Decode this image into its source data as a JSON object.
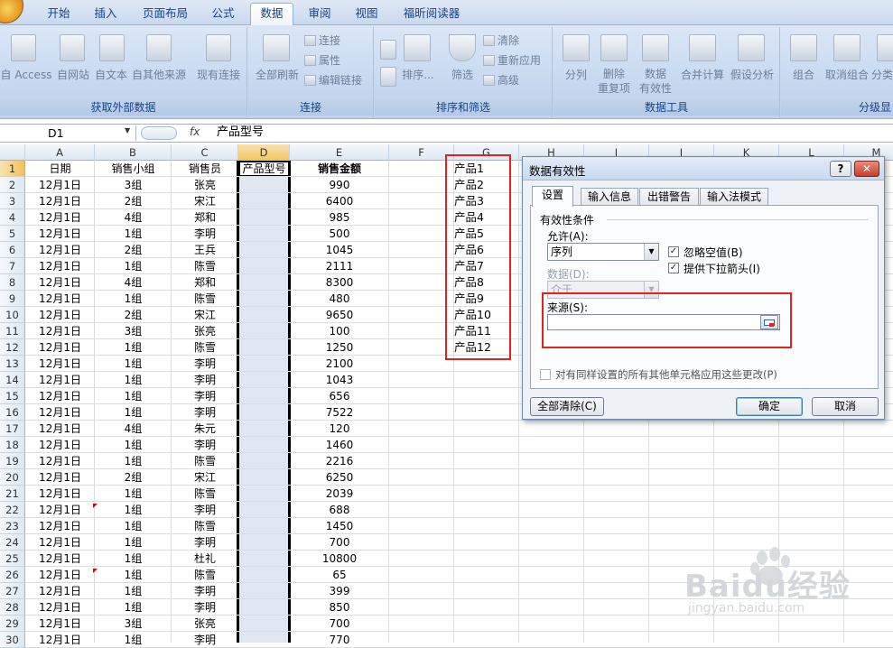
{
  "ribbon_tabs": [
    "开始",
    "插入",
    "页面布局",
    "公式",
    "数据",
    "审阅",
    "视图",
    "福昕阅读器"
  ],
  "active_tab": "数据",
  "ribbon": {
    "get_external": {
      "label": "获取外部数据",
      "buttons": [
        "自 Access",
        "自网站",
        "自文本",
        "自其他来源",
        "现有连接"
      ]
    },
    "connections": {
      "label": "连接",
      "refresh_all": "全部刷新",
      "small": [
        "连接",
        "属性",
        "编辑链接"
      ]
    },
    "sort_filter": {
      "label": "排序和筛选",
      "sort": "排序...",
      "filter": "筛选",
      "small": [
        "清除",
        "重新应用",
        "高级"
      ]
    },
    "data_tools": {
      "label": "数据工具",
      "split": "分列",
      "remove_dup": "删除\n重复项",
      "validation": "数据\n有效性",
      "consolidate": "合并计算",
      "whatif": "假设分析"
    },
    "outline": {
      "label": "分级显",
      "group": "组合",
      "ungroup": "取消组合",
      "subtotal": "分类"
    }
  },
  "formula_bar": {
    "name_box": "D1",
    "fx": "fx",
    "value": "产品型号"
  },
  "columns": [
    "A",
    "B",
    "C",
    "D",
    "E",
    "F",
    "G",
    "H",
    "I",
    "J",
    "K",
    "L",
    "M"
  ],
  "headers": {
    "a": "日期",
    "b": "销售小组",
    "c": "销售员",
    "d": "产品型号",
    "e": "销售金额"
  },
  "rows": [
    {
      "n": "1"
    },
    {
      "n": "2",
      "a": "12月1日",
      "b": "3组",
      "c": "张亮",
      "e": "990"
    },
    {
      "n": "3",
      "a": "12月1日",
      "b": "2组",
      "c": "宋江",
      "e": "6400"
    },
    {
      "n": "4",
      "a": "12月1日",
      "b": "4组",
      "c": "郑和",
      "e": "985"
    },
    {
      "n": "5",
      "a": "12月1日",
      "b": "1组",
      "c": "李明",
      "e": "500"
    },
    {
      "n": "6",
      "a": "12月1日",
      "b": "2组",
      "c": "王兵",
      "e": "1045"
    },
    {
      "n": "7",
      "a": "12月1日",
      "b": "1组",
      "c": "陈雪",
      "e": "2111"
    },
    {
      "n": "8",
      "a": "12月1日",
      "b": "4组",
      "c": "郑和",
      "e": "8300"
    },
    {
      "n": "9",
      "a": "12月1日",
      "b": "1组",
      "c": "陈雪",
      "e": "480"
    },
    {
      "n": "10",
      "a": "12月1日",
      "b": "2组",
      "c": "宋江",
      "e": "9650"
    },
    {
      "n": "11",
      "a": "12月1日",
      "b": "3组",
      "c": "张亮",
      "e": "100"
    },
    {
      "n": "12",
      "a": "12月1日",
      "b": "1组",
      "c": "陈雪",
      "e": "1250"
    },
    {
      "n": "13",
      "a": "12月1日",
      "b": "1组",
      "c": "李明",
      "e": "2100"
    },
    {
      "n": "14",
      "a": "12月1日",
      "b": "1组",
      "c": "李明",
      "e": "1043"
    },
    {
      "n": "15",
      "a": "12月1日",
      "b": "1组",
      "c": "李明",
      "e": "656"
    },
    {
      "n": "16",
      "a": "12月1日",
      "b": "1组",
      "c": "李明",
      "e": "7522"
    },
    {
      "n": "17",
      "a": "12月1日",
      "b": "4组",
      "c": "朱元",
      "e": "120"
    },
    {
      "n": "18",
      "a": "12月1日",
      "b": "1组",
      "c": "李明",
      "e": "1460"
    },
    {
      "n": "19",
      "a": "12月1日",
      "b": "1组",
      "c": "陈雪",
      "e": "2216"
    },
    {
      "n": "20",
      "a": "12月1日",
      "b": "2组",
      "c": "宋江",
      "e": "6250"
    },
    {
      "n": "21",
      "a": "12月1日",
      "b": "1组",
      "c": "陈雪",
      "e": "2039"
    },
    {
      "n": "22",
      "a": "12月1日",
      "b": "1组",
      "c": "李明",
      "e": "688"
    },
    {
      "n": "23",
      "a": "12月1日",
      "b": "1组",
      "c": "陈雪",
      "e": "1450"
    },
    {
      "n": "24",
      "a": "12月1日",
      "b": "1组",
      "c": "李明",
      "e": "700"
    },
    {
      "n": "25",
      "a": "12月1日",
      "b": "1组",
      "c": "杜礼",
      "e": "10800"
    },
    {
      "n": "26",
      "a": "12月1日",
      "b": "1组",
      "c": "陈雪",
      "e": "65"
    },
    {
      "n": "27",
      "a": "12月1日",
      "b": "1组",
      "c": "李明",
      "e": "399"
    },
    {
      "n": "28",
      "a": "12月1日",
      "b": "1组",
      "c": "李明",
      "e": "850"
    },
    {
      "n": "29",
      "a": "12月1日",
      "b": "3组",
      "c": "张亮",
      "e": "700"
    },
    {
      "n": "30",
      "a": "12月1日",
      "b": "1组",
      "c": "李明",
      "e": "770"
    }
  ],
  "product_list": [
    "产品1",
    "产品2",
    "产品3",
    "产品4",
    "产品5",
    "产品6",
    "产品7",
    "产品8",
    "产品9",
    "产品10",
    "产品11",
    "产品12"
  ],
  "dialog": {
    "title": "数据有效性",
    "help": "?",
    "close": "✕",
    "tabs": [
      "设置",
      "输入信息",
      "出错警告",
      "输入法模式"
    ],
    "criteria_label": "有效性条件",
    "allow_label": "允许(A):",
    "allow_value": "序列",
    "data_label": "数据(D):",
    "data_value": "介于",
    "ignore_blank": "忽略空值(B)",
    "dropdown": "提供下拉箭头(I)",
    "source_label": "来源(S):",
    "source_value": "",
    "apply_all": "对有同样设置的所有其他单元格应用这些更改(P)",
    "clear_all": "全部清除(C)",
    "ok": "确定",
    "cancel": "取消"
  },
  "watermark": {
    "brand": "Baidu经验",
    "url": "jingyan.baidu.com"
  }
}
